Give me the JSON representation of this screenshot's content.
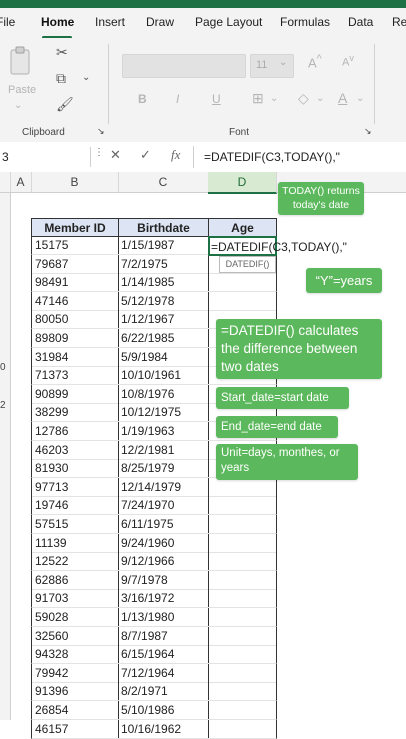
{
  "ribbon": {
    "tabs": [
      "File",
      "Home",
      "Insert",
      "Draw",
      "Page Layout",
      "Formulas",
      "Data",
      "Re"
    ],
    "active_tab": "Home",
    "groups": {
      "clipboard": "Clipboard",
      "font": "Font"
    },
    "paste_label": "Paste",
    "font_size_value": "11",
    "font_buttons": {
      "bold": "B",
      "italic": "I",
      "underline": "U"
    }
  },
  "formula_bar": {
    "name_box": "3",
    "cancel_icon": "✕",
    "enter_icon": "✓",
    "fx_label": "fx",
    "formula": "=DATEDIF(C3,TODAY(),\""
  },
  "grid": {
    "columns": [
      "A",
      "B",
      "C",
      "D"
    ],
    "row_numbers": [
      "",
      "",
      "",
      "",
      "",
      "",
      "",
      "",
      "",
      "0",
      "",
      "2",
      "",
      "",
      "",
      "",
      "",
      "",
      "",
      "",
      "",
      "",
      "",
      "",
      "",
      "",
      "",
      ""
    ],
    "headers": {
      "member_id": "Member ID",
      "birthdate": "Birthdate",
      "age": "Age"
    },
    "active_cell_text": "=DATEDIF(C3,TODAY(),\"",
    "tooltip": "DATEDIF()",
    "rows": [
      {
        "id": "15175",
        "birthdate": "1/15/1987"
      },
      {
        "id": "79687",
        "birthdate": "7/2/1975"
      },
      {
        "id": "98491",
        "birthdate": "1/14/1985"
      },
      {
        "id": "47146",
        "birthdate": "5/12/1978"
      },
      {
        "id": "80050",
        "birthdate": "1/12/1967"
      },
      {
        "id": "89809",
        "birthdate": "6/22/1985"
      },
      {
        "id": "31984",
        "birthdate": "5/9/1984"
      },
      {
        "id": "71373",
        "birthdate": "10/10/1961"
      },
      {
        "id": "90899",
        "birthdate": "10/8/1976"
      },
      {
        "id": "38299",
        "birthdate": "10/12/1975"
      },
      {
        "id": "12786",
        "birthdate": "1/19/1963"
      },
      {
        "id": "46203",
        "birthdate": "12/2/1981"
      },
      {
        "id": "81930",
        "birthdate": "8/25/1979"
      },
      {
        "id": "97713",
        "birthdate": "12/14/1979"
      },
      {
        "id": "19746",
        "birthdate": "7/24/1970"
      },
      {
        "id": "57515",
        "birthdate": "6/11/1975"
      },
      {
        "id": "11139",
        "birthdate": "9/24/1960"
      },
      {
        "id": "12522",
        "birthdate": "9/12/1966"
      },
      {
        "id": "62886",
        "birthdate": "9/7/1978"
      },
      {
        "id": "91703",
        "birthdate": "3/16/1972"
      },
      {
        "id": "59028",
        "birthdate": "1/13/1980"
      },
      {
        "id": "32560",
        "birthdate": "8/7/1987"
      },
      {
        "id": "94328",
        "birthdate": "6/15/1964"
      },
      {
        "id": "79942",
        "birthdate": "7/12/1964"
      },
      {
        "id": "91396",
        "birthdate": "8/2/1971"
      },
      {
        "id": "26854",
        "birthdate": "5/10/1986"
      },
      {
        "id": "46157",
        "birthdate": "10/16/1962"
      }
    ]
  },
  "annotations": {
    "today": "TODAY() returns today's date",
    "y_years": "“Y”=years",
    "datedif": "=DATEDIF() calculates the difference between two dates",
    "start_date": "Start_date=start date",
    "end_date": "End_date=end date",
    "unit": "Unit=days, monthes, or years"
  },
  "colors": {
    "excel_green": "#1e7145",
    "note_green": "#5cb85c",
    "header_fill": "#dde5f4"
  }
}
